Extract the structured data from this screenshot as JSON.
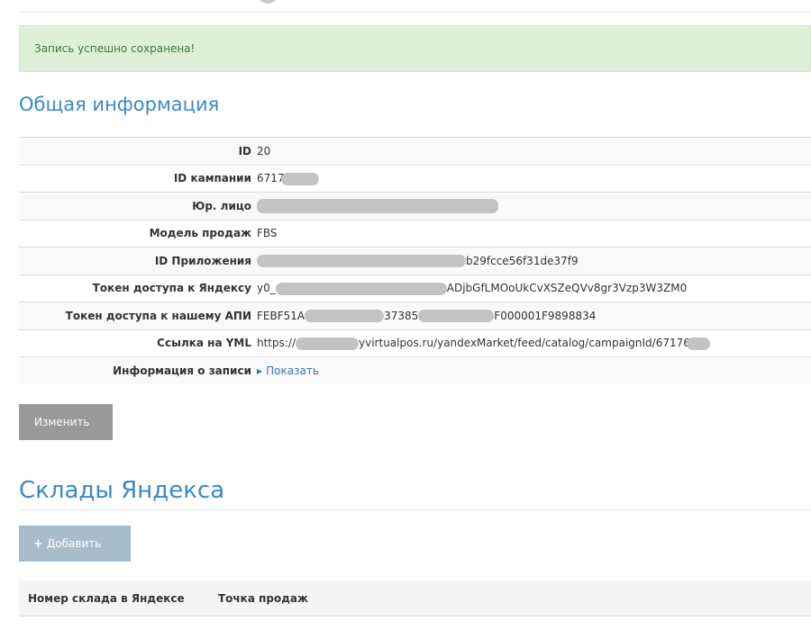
{
  "alert": {
    "message": "Запись успешно сохранена!"
  },
  "general": {
    "heading": "Общая информация",
    "rows": [
      {
        "label": "ID",
        "value": "20",
        "pre": "",
        "post": ""
      },
      {
        "label": "ID кампании",
        "value": "",
        "pre": "6717",
        "post": ""
      },
      {
        "label": "Юр. лицо",
        "value": "",
        "pre": "",
        "post": ""
      },
      {
        "label": "Модель продаж",
        "value": "FBS",
        "pre": "",
        "post": ""
      },
      {
        "label": "ID Приложения",
        "value": "",
        "pre": "",
        "post": "b29fcce56f31de37f9"
      },
      {
        "label": "Токен доступа к Яндексу",
        "value": "",
        "pre": "y0_",
        "post": "ADjbGfLMOoUkCvXSZeQVv8gr3Vzp3W3ZM0"
      },
      {
        "label": "Токен доступа к нашему АПИ",
        "value": "",
        "pre": "FEBF51A",
        "mid": "37385",
        "post": "F000001F9898834"
      },
      {
        "label": "Ссылка на YML",
        "value": "",
        "pre": "https://",
        "post": "yvirtualpos.ru/yandexMarket/feed/catalog/campaignId/67176"
      },
      {
        "label": "Информация о записи",
        "value": "Показать",
        "pre": "",
        "post": ""
      }
    ]
  },
  "actions": {
    "edit_label": "Изменить"
  },
  "warehouses": {
    "heading": "Склады Яндекса",
    "add_label": "Добавить",
    "columns": [
      "Номер склада в Яндексе",
      "Точка продаж"
    ]
  }
}
